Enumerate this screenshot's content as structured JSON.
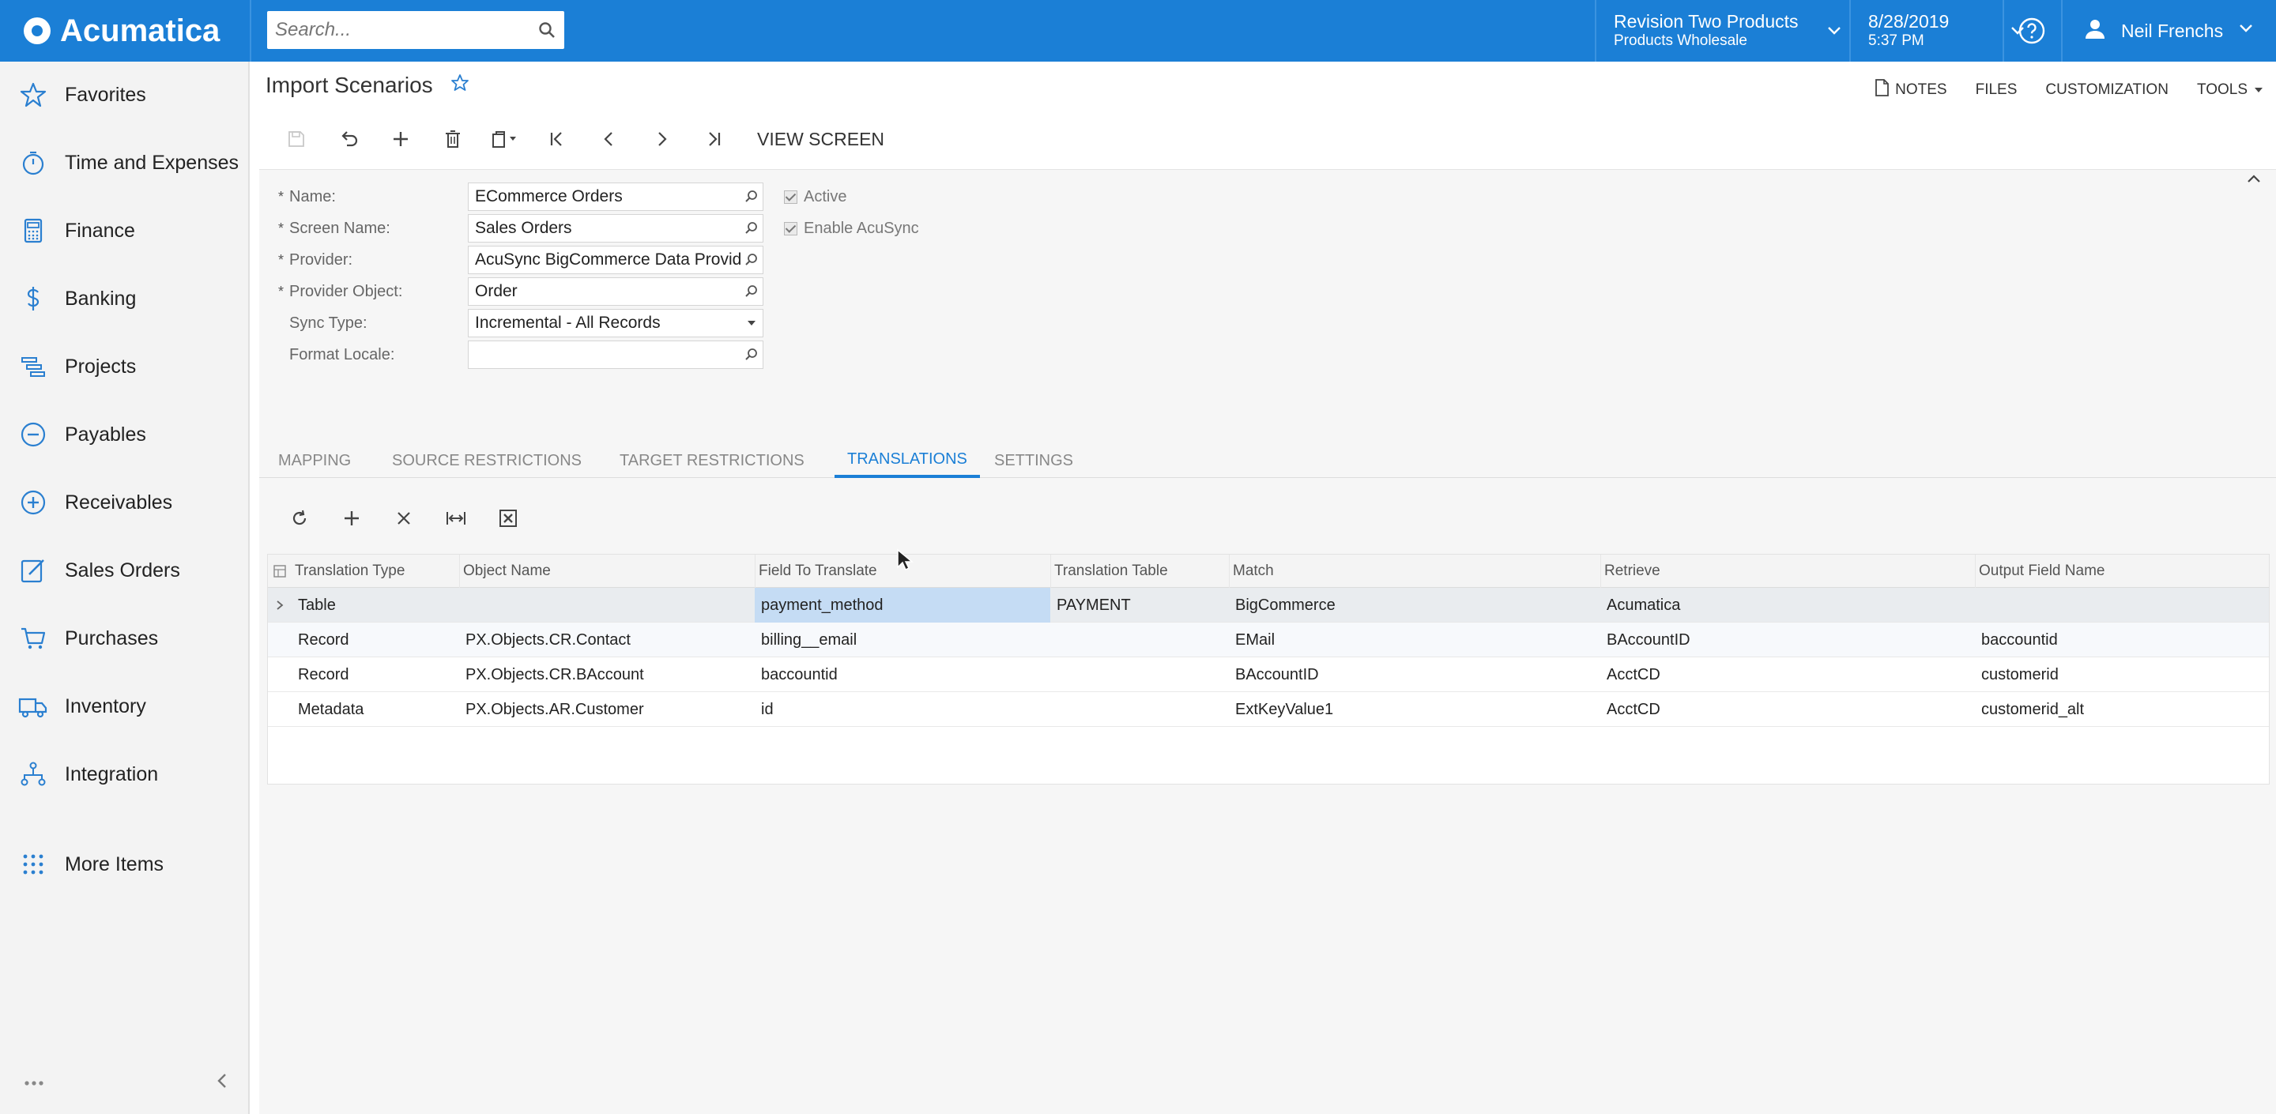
{
  "app": {
    "brand": "Acumatica"
  },
  "search": {
    "placeholder": "Search..."
  },
  "branch": {
    "name": "Revision Two Products",
    "sub": "Products Wholesale"
  },
  "datetime": {
    "date": "8/28/2019",
    "time": "5:37 PM"
  },
  "user": {
    "name": "Neil Frenchs"
  },
  "colors": {
    "accent": "#1b7fd6",
    "selection": "#c5dcf4"
  },
  "sidebar": {
    "items": [
      {
        "label": "Favorites",
        "icon": "star-icon"
      },
      {
        "label": "Time and Expenses",
        "icon": "stopwatch-icon"
      },
      {
        "label": "Finance",
        "icon": "calculator-icon"
      },
      {
        "label": "Banking",
        "icon": "dollar-icon"
      },
      {
        "label": "Projects",
        "icon": "projects-icon"
      },
      {
        "label": "Payables",
        "icon": "minus-circle-icon"
      },
      {
        "label": "Receivables",
        "icon": "plus-circle-icon"
      },
      {
        "label": "Sales Orders",
        "icon": "pencil-square-icon"
      },
      {
        "label": "Purchases",
        "icon": "cart-icon"
      },
      {
        "label": "Inventory",
        "icon": "truck-icon"
      },
      {
        "label": "Integration",
        "icon": "network-icon"
      },
      {
        "label": "More Items",
        "icon": "grid-dots-icon"
      }
    ]
  },
  "page": {
    "title": "Import Scenarios"
  },
  "top_actions": {
    "notes": "NOTES",
    "files": "FILES",
    "customization": "CUSTOMIZATION",
    "tools": "TOOLS"
  },
  "toolbar": {
    "view_screen": "VIEW SCREEN"
  },
  "form": {
    "name": {
      "label": "Name:",
      "value": "ECommerce Orders"
    },
    "screen_name": {
      "label": "Screen Name:",
      "value": "Sales Orders"
    },
    "provider": {
      "label": "Provider:",
      "value": "AcuSync BigCommerce Data Provider"
    },
    "provider_object": {
      "label": "Provider Object:",
      "value": "Order"
    },
    "sync_type": {
      "label": "Sync Type:",
      "value": "Incremental - All Records"
    },
    "format_locale": {
      "label": "Format Locale:",
      "value": ""
    },
    "active": {
      "label": "Active",
      "checked": true
    },
    "enable_acusync": {
      "label": "Enable AcuSync",
      "checked": true
    }
  },
  "tabs": [
    "MAPPING",
    "SOURCE RESTRICTIONS",
    "TARGET RESTRICTIONS",
    "TRANSLATIONS",
    "SETTINGS"
  ],
  "active_tab": "TRANSLATIONS",
  "grid": {
    "columns": [
      "Translation Type",
      "Object Name",
      "Field To Translate",
      "Translation Table",
      "Match",
      "Retrieve",
      "Output Field Name"
    ],
    "rows": [
      [
        "Table",
        "",
        "payment_method",
        "PAYMENT",
        "BigCommerce",
        "Acumatica",
        ""
      ],
      [
        "Record",
        "PX.Objects.CR.Contact",
        "billing__email",
        "",
        "EMail",
        "BAccountID",
        "baccountid"
      ],
      [
        "Record",
        "PX.Objects.CR.BAccount",
        "baccountid",
        "",
        "BAccountID",
        "AcctCD",
        "customerid"
      ],
      [
        "Metadata",
        "PX.Objects.AR.Customer",
        "id",
        "",
        "ExtKeyValue1",
        "AcctCD",
        "customerid_alt"
      ]
    ]
  }
}
